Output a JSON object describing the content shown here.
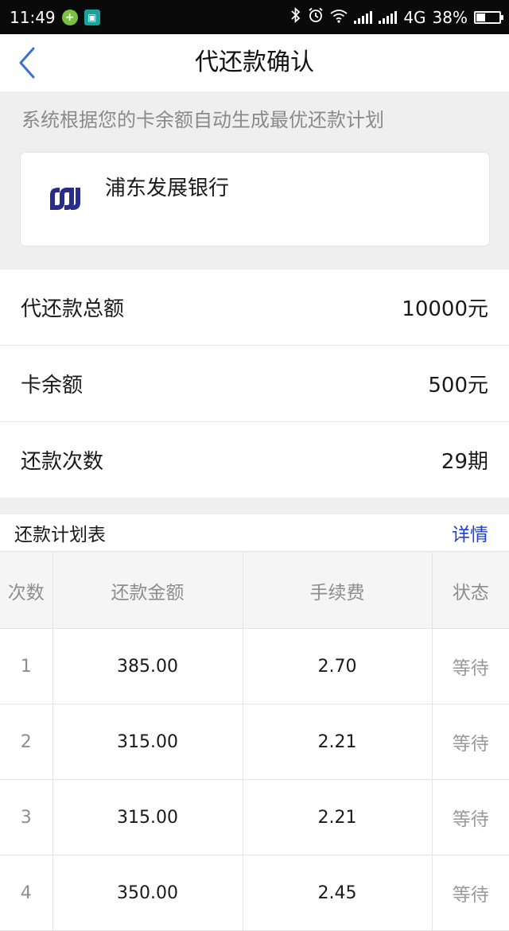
{
  "status_bar": {
    "time": "11:49",
    "network": "4G",
    "battery": "38%",
    "battery_level": 0.38
  },
  "nav": {
    "title": "代还款确认"
  },
  "notice": "系统根据您的卡余额自动生成最优还款计划",
  "bank": {
    "name": "浦东发展银行",
    "logo_color": "#2a2c8a"
  },
  "summary": [
    {
      "label": "代还款总额",
      "value": "10000元"
    },
    {
      "label": "卡余额",
      "value": "500元"
    },
    {
      "label": "还款次数",
      "value": "29期"
    }
  ],
  "plan": {
    "title": "还款计划表",
    "detail_label": "详情",
    "detail_color": "#1f3fd8",
    "columns": [
      "次数",
      "还款金额",
      "手续费",
      "状态"
    ],
    "rows": [
      {
        "index": "1",
        "amount": "385.00",
        "fee": "2.70",
        "status": "等待"
      },
      {
        "index": "2",
        "amount": "315.00",
        "fee": "2.21",
        "status": "等待"
      },
      {
        "index": "3",
        "amount": "315.00",
        "fee": "2.21",
        "status": "等待"
      },
      {
        "index": "4",
        "amount": "350.00",
        "fee": "2.45",
        "status": "等待"
      }
    ]
  }
}
